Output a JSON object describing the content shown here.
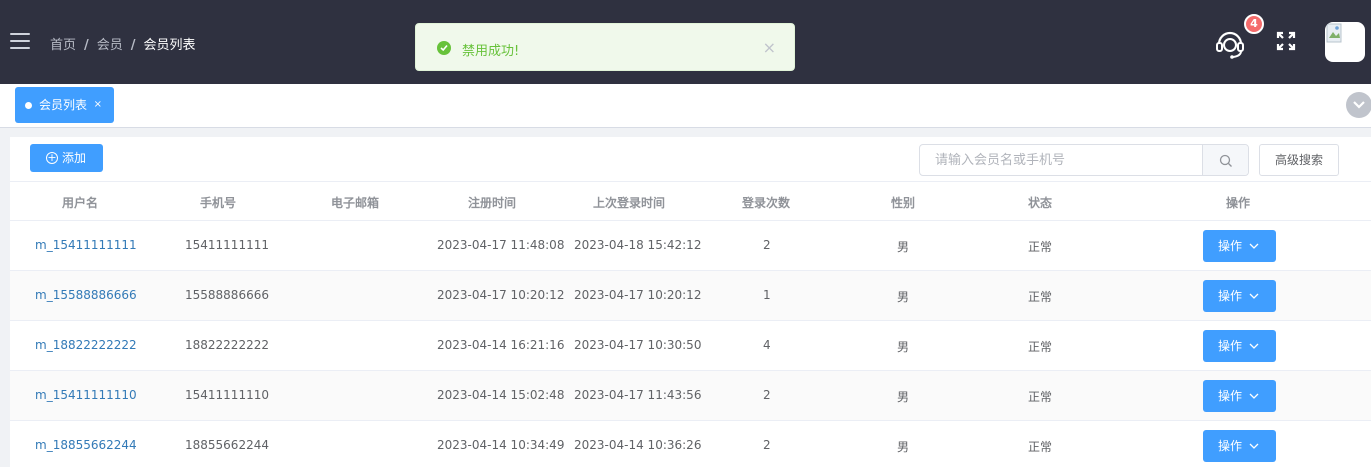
{
  "header": {
    "breadcrumb": [
      "首页",
      "会员",
      "会员列表"
    ],
    "notification_count": "4",
    "toast": {
      "message": "禁用成功!",
      "close": "×"
    }
  },
  "tags": {
    "active": "会员列表",
    "close": "×"
  },
  "toolbar": {
    "add_label": "添加",
    "search_placeholder": "请输入会员名或手机号",
    "advanced_search_label": "高级搜索"
  },
  "table": {
    "columns": [
      "用户名",
      "手机号",
      "电子邮箱",
      "注册时间",
      "上次登录时间",
      "登录次数",
      "性别",
      "状态",
      "操作"
    ],
    "rows": [
      {
        "username": "m_15411111111",
        "phone": "15411111111",
        "email": "",
        "registered": "2023-04-17 11:48:08",
        "last_login": "2023-04-18 15:42:12",
        "login_count": "2",
        "gender": "男",
        "status": "正常",
        "action": "操作"
      },
      {
        "username": "m_15588886666",
        "phone": "15588886666",
        "email": "",
        "registered": "2023-04-17 10:20:12",
        "last_login": "2023-04-17 10:20:12",
        "login_count": "1",
        "gender": "男",
        "status": "正常",
        "action": "操作"
      },
      {
        "username": "m_18822222222",
        "phone": "18822222222",
        "email": "",
        "registered": "2023-04-14 16:21:16",
        "last_login": "2023-04-17 10:30:50",
        "login_count": "4",
        "gender": "男",
        "status": "正常",
        "action": "操作"
      },
      {
        "username": "m_15411111110",
        "phone": "15411111110",
        "email": "",
        "registered": "2023-04-14 15:02:48",
        "last_login": "2023-04-17 11:43:56",
        "login_count": "2",
        "gender": "男",
        "status": "正常",
        "action": "操作"
      },
      {
        "username": "m_18855662244",
        "phone": "18855662244",
        "email": "",
        "registered": "2023-04-14 10:34:49",
        "last_login": "2023-04-14 10:36:26",
        "login_count": "2",
        "gender": "男",
        "status": "正常",
        "action": "操作"
      }
    ]
  },
  "colors": {
    "primary": "#409eff",
    "header_bg": "#2f3140",
    "success": "#67c23a",
    "badge": "#f56c6c"
  }
}
